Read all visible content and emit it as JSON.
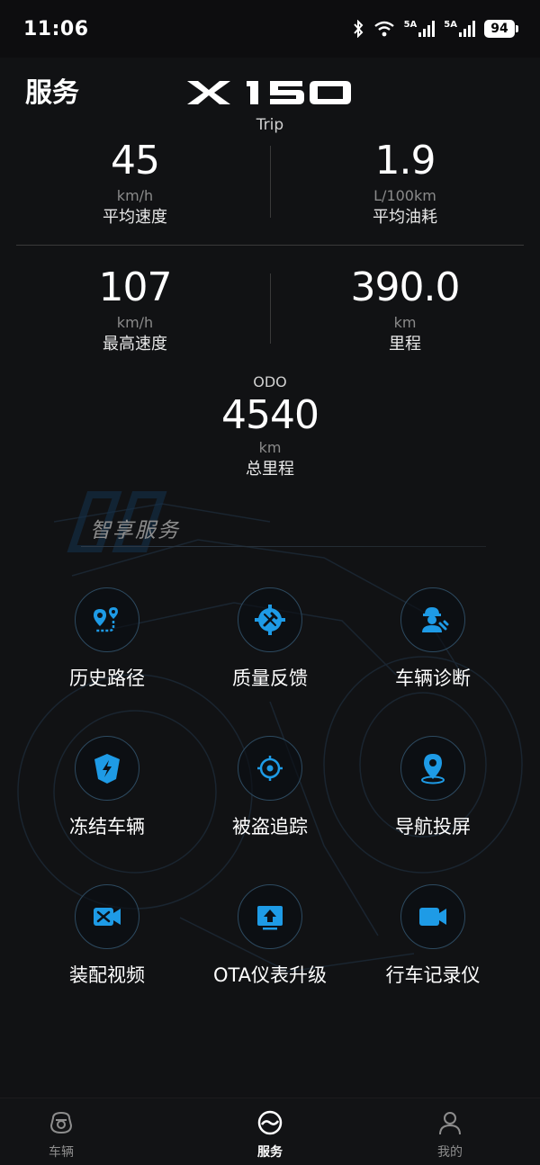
{
  "status_bar": {
    "time": "11:06",
    "network1": "5A",
    "network2": "5A",
    "battery": "94",
    "icons": [
      "bluetooth-icon",
      "wifi-icon",
      "signal-icon",
      "signal-icon",
      "battery-icon"
    ]
  },
  "header": {
    "title": "服务",
    "brand_logo": "X 150",
    "trip_label": "Trip"
  },
  "stats": [
    {
      "value": "45",
      "unit": "km/h",
      "label": "平均速度"
    },
    {
      "value": "1.9",
      "unit": "L/100km",
      "label": "平均油耗"
    },
    {
      "value": "107",
      "unit": "km/h",
      "label": "最高速度"
    },
    {
      "value": "390.0",
      "unit": "km",
      "label": "里程"
    }
  ],
  "odo": {
    "caption": "ODO",
    "value": "4540",
    "unit": "km",
    "label": "总里程"
  },
  "services_section": {
    "title": "智享服务",
    "items": [
      {
        "label": "历史路径",
        "icon": "route-history-icon"
      },
      {
        "label": "质量反馈",
        "icon": "quality-feedback-icon"
      },
      {
        "label": "车辆诊断",
        "icon": "vehicle-diagnosis-icon"
      },
      {
        "label": "冻结车辆",
        "icon": "freeze-vehicle-icon"
      },
      {
        "label": "被盗追踪",
        "icon": "theft-tracking-icon"
      },
      {
        "label": "导航投屏",
        "icon": "navigation-cast-icon"
      },
      {
        "label": "装配视频",
        "icon": "assembly-video-icon"
      },
      {
        "label": "OTA仪表升级",
        "icon": "ota-upgrade-icon"
      },
      {
        "label": "行车记录仪",
        "icon": "dashcam-icon"
      }
    ]
  },
  "colors": {
    "accent": "#1e9be6",
    "background": "#111214",
    "muted_text": "#8a8a8a"
  },
  "bottom_nav": {
    "items": [
      {
        "label": "车辆",
        "icon": "motorcycle-icon",
        "active": false
      },
      {
        "label": "服务",
        "icon": "service-icon",
        "active": true
      },
      {
        "label": "我的",
        "icon": "profile-icon",
        "active": false
      }
    ]
  }
}
